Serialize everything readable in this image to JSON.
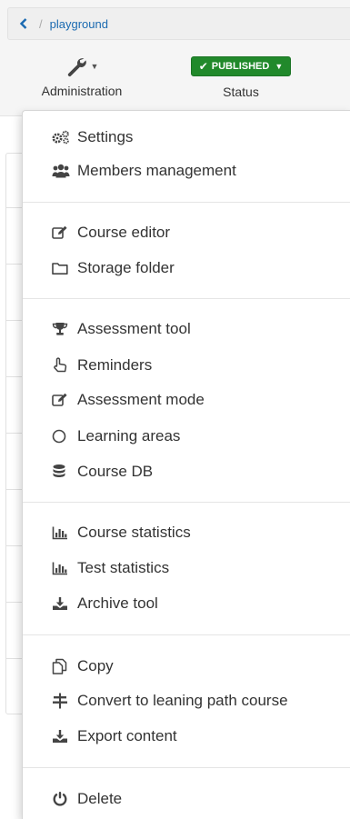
{
  "breadcrumb": {
    "back_icon": "chevron-left-icon",
    "separator": "/",
    "current": "playground"
  },
  "toolbar": {
    "administration": {
      "icon": "wrench-icon",
      "label": "Administration"
    },
    "status": {
      "button_label": "PUBLISHED",
      "label": "Status",
      "color": "#21892b"
    }
  },
  "menu": {
    "items": [
      {
        "label": "Settings",
        "icon": "gears-icon"
      },
      {
        "label": "Members management",
        "icon": "users-icon"
      },
      {
        "label": "Course editor",
        "icon": "edit-icon"
      },
      {
        "label": "Storage folder",
        "icon": "folder-icon"
      },
      {
        "label": "Assessment tool",
        "icon": "trophy-icon"
      },
      {
        "label": "Reminders",
        "icon": "hand-pointer-icon"
      },
      {
        "label": "Assessment mode",
        "icon": "edit-icon"
      },
      {
        "label": "Learning areas",
        "icon": "circle-icon"
      },
      {
        "label": "Course DB",
        "icon": "database-icon"
      },
      {
        "label": "Course statistics",
        "icon": "bar-chart-icon"
      },
      {
        "label": "Test statistics",
        "icon": "bar-chart-icon"
      },
      {
        "label": "Archive tool",
        "icon": "download-icon"
      },
      {
        "label": "Copy",
        "icon": "copy-icon"
      },
      {
        "label": "Convert to leaning path course",
        "icon": "convert-icon"
      },
      {
        "label": "Export content",
        "icon": "download-icon"
      },
      {
        "label": "Delete",
        "icon": "power-icon"
      }
    ]
  }
}
